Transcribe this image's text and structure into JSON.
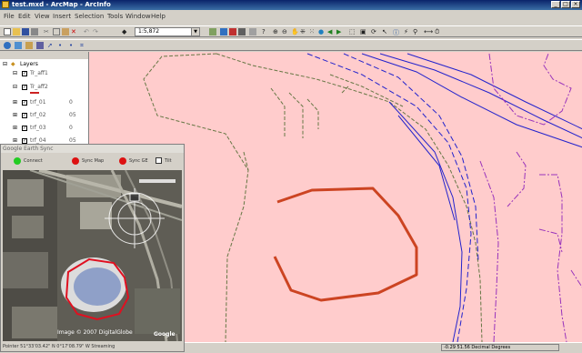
{
  "window": {
    "title": "test.mxd - ArcMap - ArcInfo"
  },
  "menubar": {
    "items": [
      "File",
      "Edit",
      "View",
      "Insert",
      "Selection",
      "Tools",
      "Window",
      "Help"
    ]
  },
  "toolbar": {
    "scale": "1:5,872"
  },
  "toc": {
    "title": "Layers",
    "layers": [
      {
        "label": "Tr_aff1",
        "extra": ""
      },
      {
        "label": "Tr_aff2",
        "extra": ""
      },
      {
        "label": "trf_01",
        "extra": "0"
      },
      {
        "label": "trf_02",
        "extra": "05"
      },
      {
        "label": "trf_03",
        "extra": "0"
      },
      {
        "label": "trf_04",
        "extra": "05"
      }
    ]
  },
  "google_earth": {
    "title": "Google Earth Sync",
    "controls": [
      {
        "label": "Connect",
        "color": "#22cc22"
      },
      {
        "label": "Sync Map",
        "color": "#dd1111"
      },
      {
        "label": "Sync GE",
        "color": "#dd1111"
      },
      {
        "label": "Tilt",
        "color": ""
      }
    ],
    "imagery_credit": "Image © 2007 DigitalGlobe",
    "logo": "Google",
    "status": "Pointer 51°33'03.42\" N  0°17'08.79\" W   Streaming"
  },
  "statusbar": {
    "coordinates": "-0.29 51.56 Decimal Degrees"
  },
  "colors": {
    "map_background": "#ffcccc",
    "feature_outline": "#cc4422"
  }
}
